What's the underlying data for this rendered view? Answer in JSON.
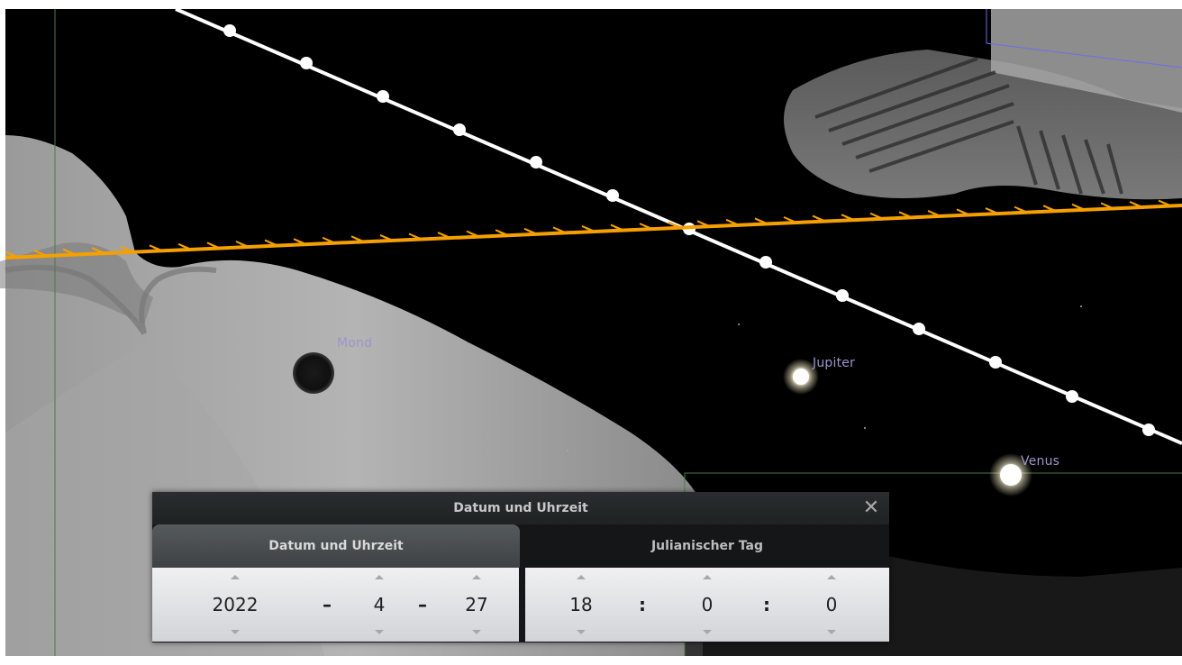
{
  "sky": {
    "labels": {
      "moon": "Mond",
      "jupiter": "Jupiter",
      "venus": "Venus"
    },
    "colors": {
      "ecliptic": "#f5a000",
      "equator": "#ffffff",
      "label": "#9c96c8",
      "grid_green": "#4a7a4a",
      "constellation_blue": "#6c6cf0"
    }
  },
  "dialog": {
    "title": "Datum und Uhrzeit",
    "close_icon": "close-icon",
    "tabs": [
      {
        "label": "Datum und Uhrzeit",
        "active": true
      },
      {
        "label": "Julianischer Tag",
        "active": false
      }
    ],
    "date": {
      "year": "2022",
      "month": "4",
      "day": "27",
      "separator": "–"
    },
    "time": {
      "hour": "18",
      "minute": "0",
      "second": "0",
      "separator": ":"
    }
  }
}
